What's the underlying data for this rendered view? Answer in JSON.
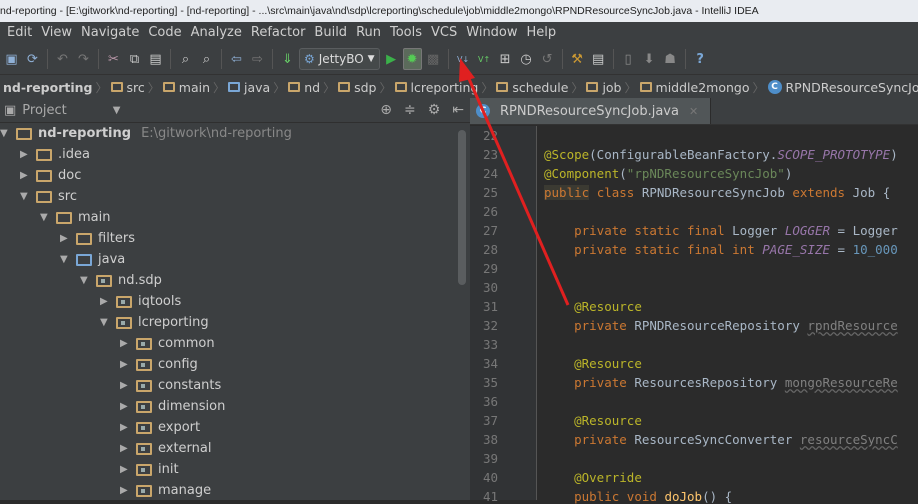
{
  "title": "nd-reporting - [E:\\gitwork\\nd-reporting] - [nd-reporting] - ...\\src\\main\\java\\nd\\sdp\\lcreporting\\schedule\\job\\middle2mongo\\RPNDResourceSyncJob.java - IntelliJ IDEA",
  "menu": [
    "Edit",
    "View",
    "Navigate",
    "Code",
    "Analyze",
    "Refactor",
    "Build",
    "Run",
    "Tools",
    "VCS",
    "Window",
    "Help"
  ],
  "toolbar": {
    "run_config": "JettyBO"
  },
  "breadcrumb": [
    "nd-reporting",
    "src",
    "main",
    "java",
    "nd",
    "sdp",
    "lcreporting",
    "schedule",
    "job",
    "middle2mongo",
    "RPNDResourceSyncJob"
  ],
  "project": {
    "label": "Project",
    "tree": [
      {
        "label": "nd-reporting",
        "path": "E:\\gitwork\\nd-reporting",
        "depth": 0,
        "expanded": true
      },
      {
        "label": ".idea",
        "depth": 1,
        "expanded": false
      },
      {
        "label": "doc",
        "depth": 1,
        "expanded": false
      },
      {
        "label": "src",
        "depth": 1,
        "expanded": true
      },
      {
        "label": "main",
        "depth": 2,
        "expanded": true
      },
      {
        "label": "filters",
        "depth": 3,
        "expanded": false
      },
      {
        "label": "java",
        "depth": 3,
        "expanded": true
      },
      {
        "label": "nd.sdp",
        "depth": 4,
        "expanded": true
      },
      {
        "label": "iqtools",
        "depth": 5,
        "expanded": false
      },
      {
        "label": "lcreporting",
        "depth": 5,
        "expanded": true
      },
      {
        "label": "common",
        "depth": 6,
        "expanded": false
      },
      {
        "label": "config",
        "depth": 6,
        "expanded": false
      },
      {
        "label": "constants",
        "depth": 6,
        "expanded": false
      },
      {
        "label": "dimension",
        "depth": 6,
        "expanded": false
      },
      {
        "label": "export",
        "depth": 6,
        "expanded": false
      },
      {
        "label": "external",
        "depth": 6,
        "expanded": false
      },
      {
        "label": "init",
        "depth": 6,
        "expanded": false
      },
      {
        "label": "manage",
        "depth": 6,
        "expanded": false
      }
    ]
  },
  "editor": {
    "tab": "RPNDResourceSyncJob.java",
    "lines": [
      {
        "n": "22",
        "t": []
      },
      {
        "n": "23",
        "t": [
          [
            "@Scope",
            "ann"
          ],
          [
            "(ConfigurableBeanFactory.",
            ""
          ],
          [
            "SCOPE_PROTOTYPE",
            "const"
          ],
          [
            ")",
            ""
          ]
        ]
      },
      {
        "n": "24",
        "t": [
          [
            "@Component",
            "ann"
          ],
          [
            "(",
            ""
          ],
          [
            "\"rpNDResourceSyncJob\"",
            "str"
          ],
          [
            ")",
            ""
          ]
        ]
      },
      {
        "n": "25",
        "t": [
          [
            "public",
            "kw hl"
          ],
          [
            " ",
            ""
          ],
          [
            "class",
            "kw"
          ],
          [
            " RPNDResourceSyncJob ",
            ""
          ],
          [
            "extends",
            "kw"
          ],
          [
            " Job {",
            ""
          ]
        ]
      },
      {
        "n": "26",
        "t": []
      },
      {
        "n": "27",
        "t": [
          [
            "    ",
            ""
          ],
          [
            "private static final",
            "kw"
          ],
          [
            " Logger ",
            ""
          ],
          [
            "LOGGER",
            "const"
          ],
          [
            " = Logger",
            ""
          ]
        ]
      },
      {
        "n": "28",
        "t": [
          [
            "    ",
            ""
          ],
          [
            "private static final int",
            "kw"
          ],
          [
            " ",
            ""
          ],
          [
            "PAGE_SIZE",
            "const"
          ],
          [
            " = ",
            ""
          ],
          [
            "10_000",
            "num"
          ]
        ]
      },
      {
        "n": "29",
        "t": []
      },
      {
        "n": "30",
        "t": []
      },
      {
        "n": "31",
        "t": [
          [
            "    ",
            ""
          ],
          [
            "@Resource",
            "ann"
          ]
        ]
      },
      {
        "n": "32",
        "t": [
          [
            "    ",
            ""
          ],
          [
            "private",
            "kw"
          ],
          [
            " RPNDResourceRepository ",
            ""
          ],
          [
            "rpndResource",
            "field"
          ]
        ]
      },
      {
        "n": "33",
        "t": []
      },
      {
        "n": "34",
        "t": [
          [
            "    ",
            ""
          ],
          [
            "@Resource",
            "ann"
          ]
        ]
      },
      {
        "n": "35",
        "t": [
          [
            "    ",
            ""
          ],
          [
            "private",
            "kw"
          ],
          [
            " ResourcesRepository ",
            ""
          ],
          [
            "mongoResourceRe",
            "field"
          ]
        ]
      },
      {
        "n": "36",
        "t": []
      },
      {
        "n": "37",
        "t": [
          [
            "    ",
            ""
          ],
          [
            "@Resource",
            "ann"
          ]
        ]
      },
      {
        "n": "38",
        "t": [
          [
            "    ",
            ""
          ],
          [
            "private",
            "kw"
          ],
          [
            " ResourceSyncConverter ",
            ""
          ],
          [
            "resourceSyncC",
            "field"
          ]
        ]
      },
      {
        "n": "39",
        "t": []
      },
      {
        "n": "40",
        "t": [
          [
            "    ",
            ""
          ],
          [
            "@Override",
            "ann"
          ]
        ]
      },
      {
        "n": "41",
        "t": [
          [
            "    ",
            ""
          ],
          [
            "public void",
            "kw"
          ],
          [
            " ",
            ""
          ],
          [
            "doJob",
            "method"
          ],
          [
            "() {",
            ""
          ]
        ]
      }
    ]
  },
  "annotation_color": "#e02020"
}
